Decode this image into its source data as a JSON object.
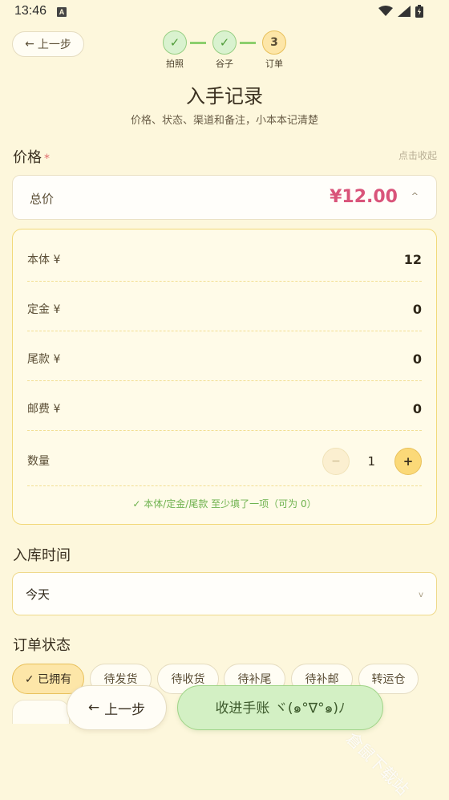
{
  "status_bar": {
    "time": "13:46",
    "notification_badge": "A"
  },
  "header": {
    "back_label": "上一步",
    "steps": [
      {
        "mark": "✓",
        "label": "拍照",
        "state": "done"
      },
      {
        "mark": "✓",
        "label": "谷子",
        "state": "done"
      },
      {
        "mark": "3",
        "label": "订单",
        "state": "current"
      }
    ],
    "title": "入手记录",
    "subtitle": "价格、状态、渠道和备注，小本本记清楚"
  },
  "price_section": {
    "label": "价格",
    "required_mark": "*",
    "collapse_link": "点击收起",
    "total_label": "总价",
    "total_value": "¥12.00",
    "total_caret": "^",
    "rows": [
      {
        "label": "本体 ¥",
        "value": "12"
      },
      {
        "label": "定金 ¥",
        "value": "0"
      },
      {
        "label": "尾款 ¥",
        "value": "0"
      },
      {
        "label": "邮费 ¥",
        "value": "0"
      }
    ],
    "quantity": {
      "label": "数量",
      "minus": "−",
      "value": "1",
      "plus": "+"
    },
    "hint": "✓ 本体/定金/尾款 至少填了一项（可为 0）"
  },
  "date_section": {
    "label": "入库时间",
    "value": "今天",
    "caret": "v"
  },
  "order_status": {
    "label": "订单状态",
    "chips": [
      {
        "label": "✓ 已拥有",
        "selected": true
      },
      {
        "label": "待发货",
        "selected": false
      },
      {
        "label": "待收货",
        "selected": false
      },
      {
        "label": "待补尾",
        "selected": false
      },
      {
        "label": "待补邮",
        "selected": false
      },
      {
        "label": "转运仓",
        "selected": false
      }
    ]
  },
  "footer": {
    "back_label": "上一步",
    "submit_label": "收进手账 ヾ(๑°∇°๑)ﾉ"
  },
  "watermark": "倉鼠下载站",
  "colors": {
    "background": "#fdf7dc",
    "accent_yellow": "#fbd978",
    "success_green": "#8ccf6d",
    "price_pink": "#d9547a"
  }
}
